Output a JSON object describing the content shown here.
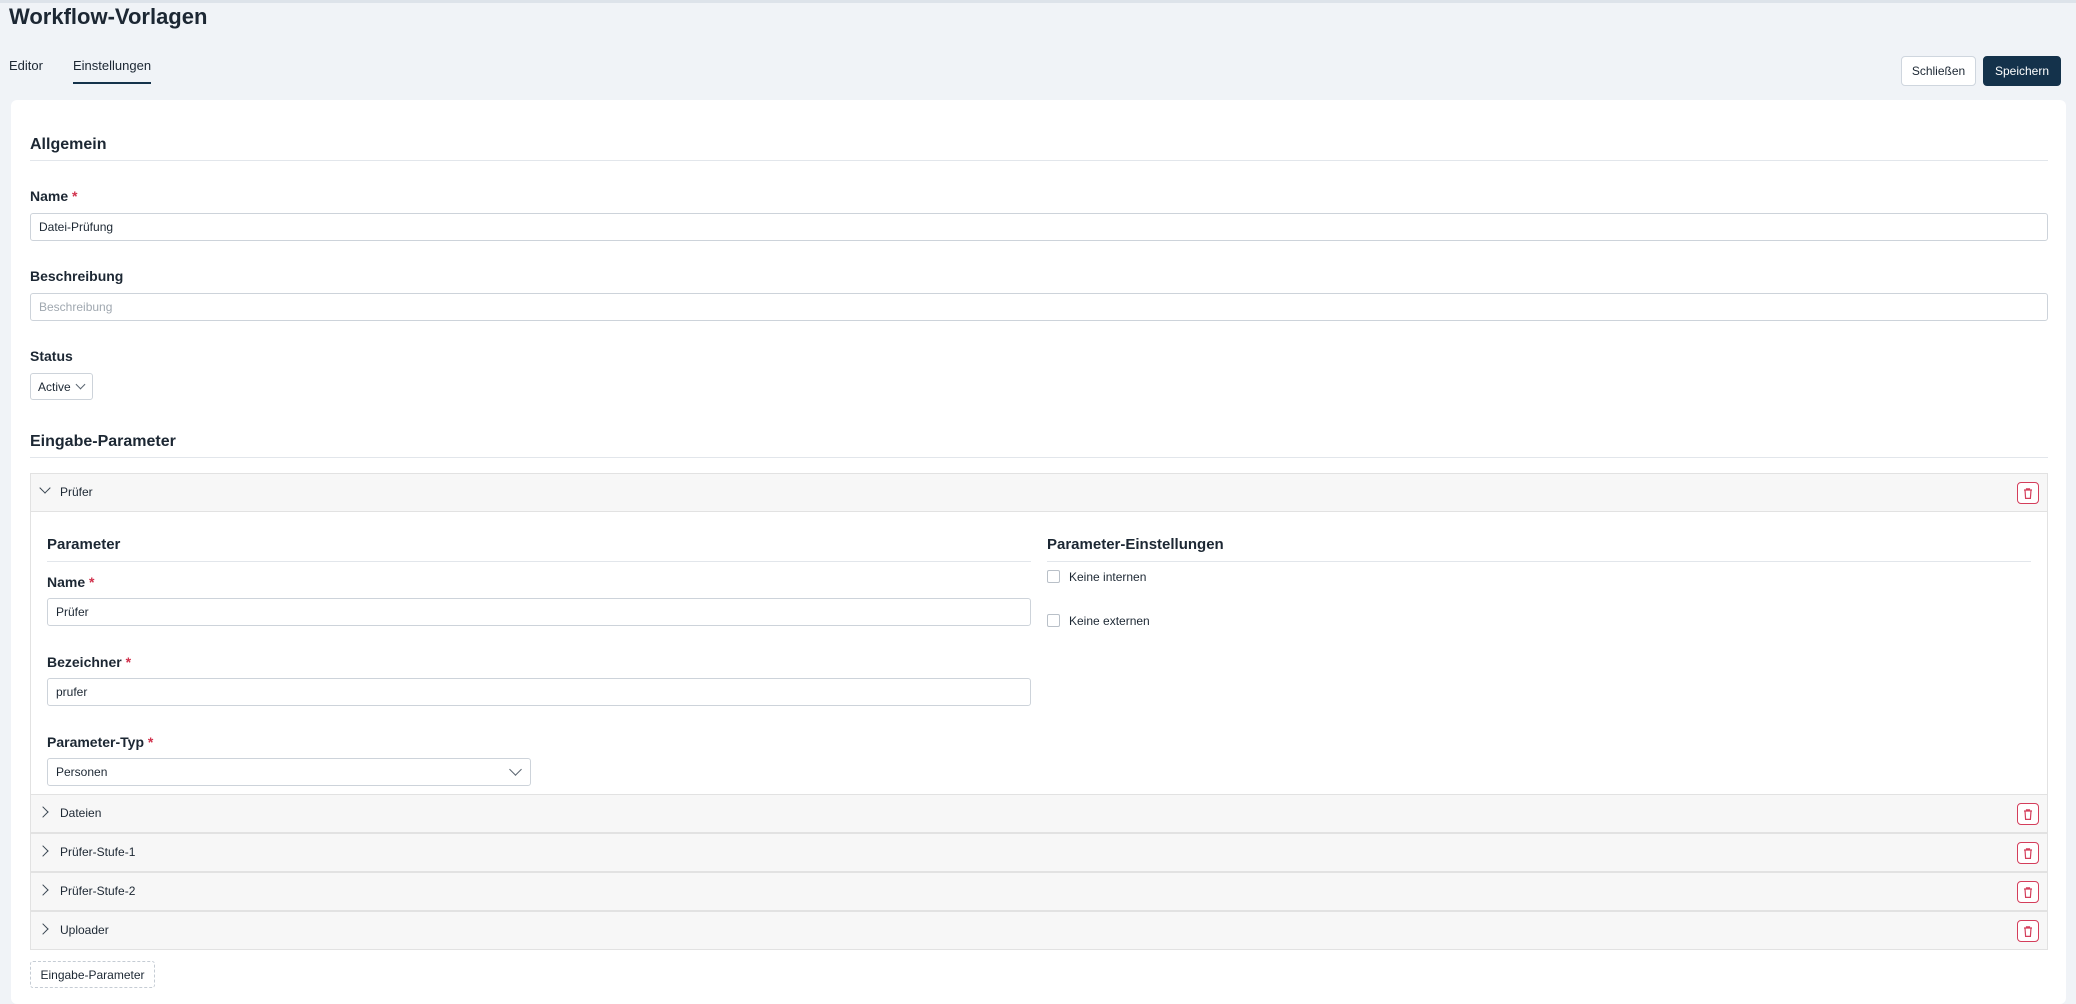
{
  "page": {
    "title": "Workflow-Vorlagen"
  },
  "tabs": [
    {
      "label": "Editor",
      "active": false
    },
    {
      "label": "Einstellungen",
      "active": true
    }
  ],
  "toolbar": {
    "close_label": "Schließen",
    "save_label": "Speichern"
  },
  "general": {
    "section_title": "Allgemein",
    "name": {
      "label": "Name",
      "required_mark": "*",
      "value": "Datei-Prüfung"
    },
    "description": {
      "label": "Beschreibung",
      "placeholder": "Beschreibung",
      "value": ""
    },
    "status": {
      "label": "Status",
      "value": "Active"
    }
  },
  "input_params": {
    "section_title": "Eingabe-Parameter",
    "add_button_label": "Eingabe-Parameter",
    "items": [
      {
        "label": "Prüfer",
        "expanded": true
      },
      {
        "label": "Dateien",
        "expanded": false
      },
      {
        "label": "Prüfer-Stufe-1",
        "expanded": false
      },
      {
        "label": "Prüfer-Stufe-2",
        "expanded": false
      },
      {
        "label": "Uploader",
        "expanded": false
      }
    ],
    "expanded_item": {
      "parameter_title": "Parameter",
      "name": {
        "label": "Name",
        "required_mark": "*",
        "value": "Prüfer"
      },
      "identifier": {
        "label": "Bezeichner",
        "required_mark": "*",
        "value": "prufer"
      },
      "type": {
        "label": "Parameter-Typ",
        "required_mark": "*",
        "value": "Personen"
      },
      "settings_title": "Parameter-Einstellungen",
      "settings": [
        {
          "label": "Keine internen",
          "checked": false
        },
        {
          "label": "Keine externen",
          "checked": false
        }
      ]
    }
  },
  "colors": {
    "accent": "#14324b",
    "danger": "#d43e5b",
    "background": "#f0f3f7"
  },
  "icons": {
    "delete": "trash-icon",
    "expand": "chevron-right-icon",
    "collapse": "chevron-down-icon",
    "select": "chevron-down-icon"
  }
}
